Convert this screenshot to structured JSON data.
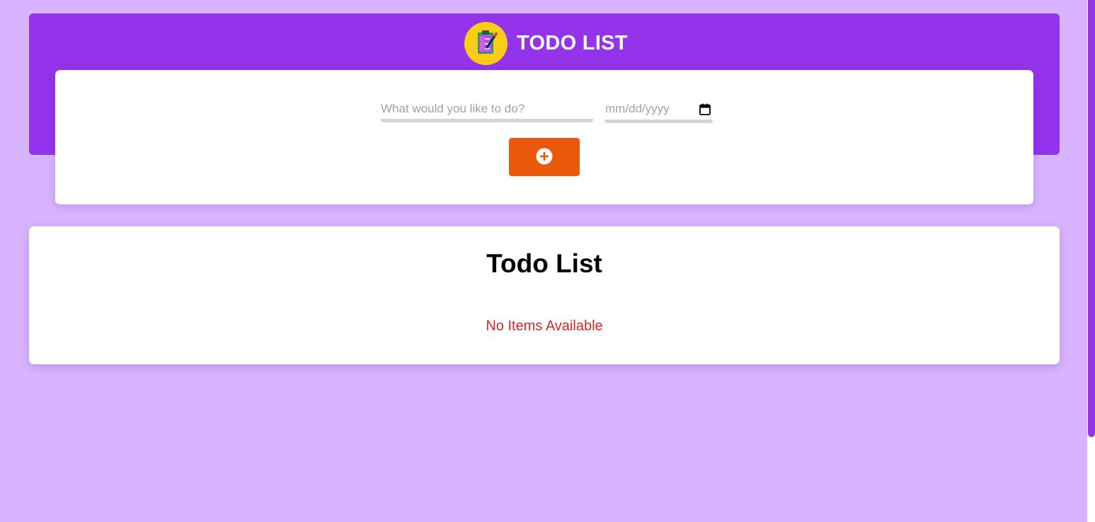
{
  "header": {
    "title": "TODO LIST",
    "logo_icon": "clipboard-checklist-icon",
    "band_color": "#9333ea"
  },
  "form": {
    "task_placeholder": "What would you like to do?",
    "task_value": "",
    "date_placeholder": "mm/dd/yyyy",
    "date_value": "",
    "date_icon": "calendar-icon",
    "add_icon": "plus-circle-icon",
    "add_button_color": "#ea580c"
  },
  "list": {
    "title": "Todo List",
    "empty_message": "No Items Available",
    "empty_color": "#dc2626",
    "items": []
  },
  "page": {
    "background": "#d8b4fe"
  }
}
